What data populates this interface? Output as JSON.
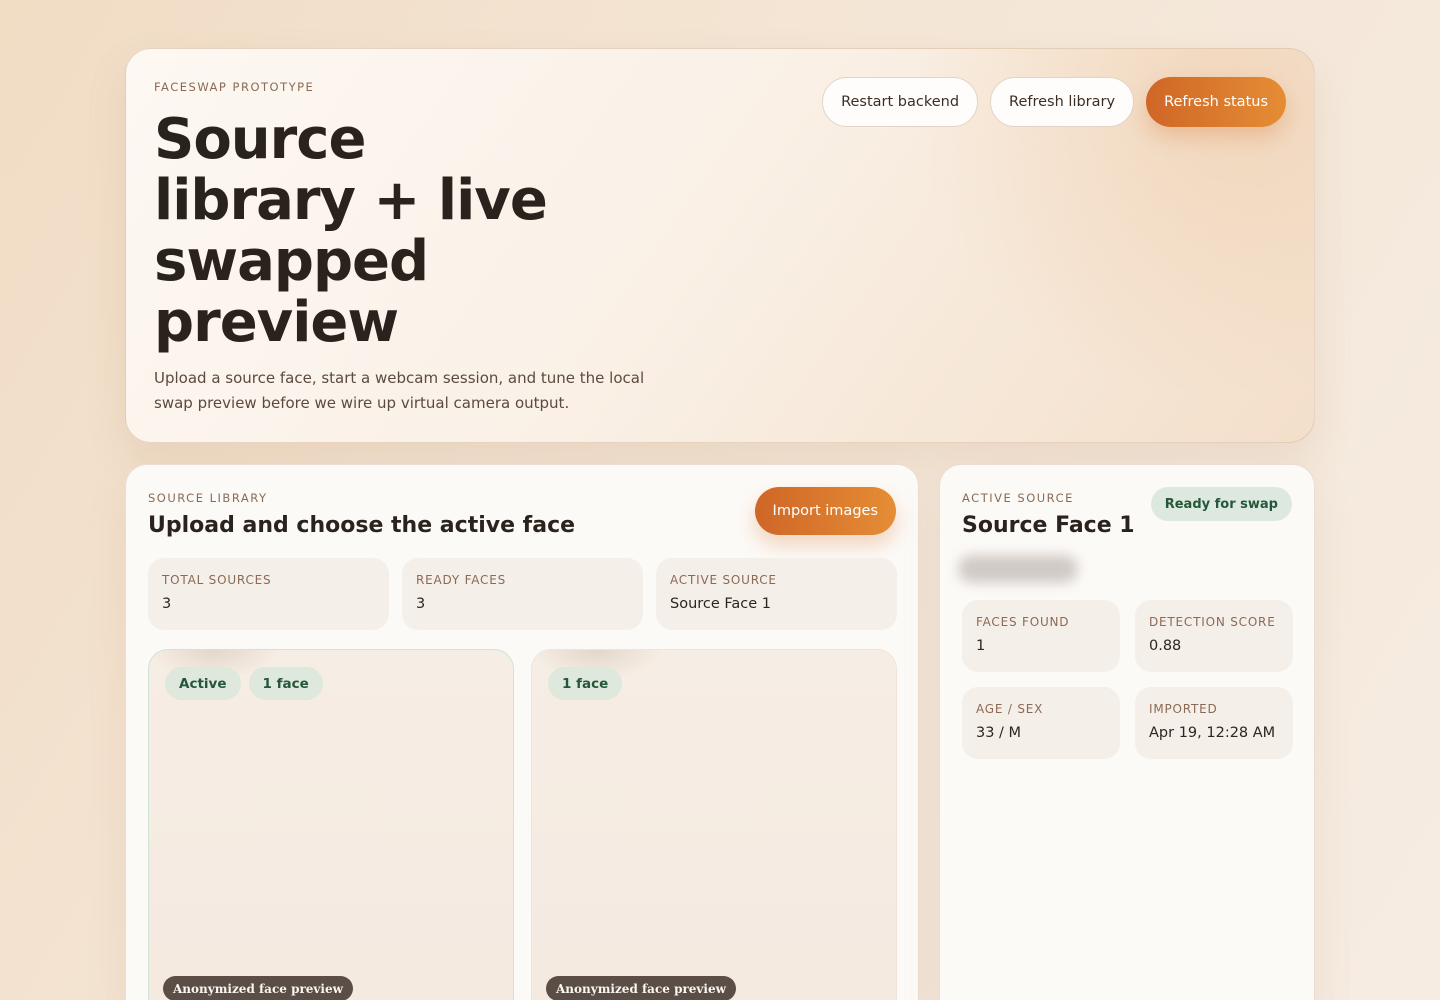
{
  "hero": {
    "eyebrow": "FACESWAP PROTOTYPE",
    "title": "Source library + live swapped preview",
    "subtitle": "Upload a source face, start a webcam session, and tune the local swap preview before we wire up virtual camera output.",
    "actions": {
      "restart_label": "Restart backend",
      "refresh_library_label": "Refresh library",
      "refresh_status_label": "Refresh status"
    }
  },
  "library": {
    "eyebrow": "SOURCE LIBRARY",
    "title": "Upload and choose the active face",
    "import_label": "Import images",
    "stats": [
      {
        "label": "TOTAL SOURCES",
        "value": "3"
      },
      {
        "label": "READY FACES",
        "value": "3"
      },
      {
        "label": "ACTIVE SOURCE",
        "value": "Source Face 1"
      }
    ],
    "tiles": [
      {
        "badges": [
          "Active",
          "1 face"
        ],
        "caption": "Anonymized face preview"
      },
      {
        "badges": [
          "1 face"
        ],
        "caption": "Anonymized face preview"
      }
    ]
  },
  "active": {
    "eyebrow": "ACTIVE SOURCE",
    "title": "Source Face 1",
    "status": "Ready for swap",
    "details": [
      {
        "label": "FACES FOUND",
        "value": "1"
      },
      {
        "label": "DETECTION SCORE",
        "value": "0.88"
      },
      {
        "label": "AGE / SEX",
        "value": "33 / M"
      },
      {
        "label": "IMPORTED",
        "value": "Apr 19, 12:28 AM"
      }
    ]
  },
  "colors": {
    "accent": "#d9762f",
    "success_bg": "#dfe8dc",
    "success_text": "#24573a",
    "caption_bg": "#5a4e46"
  }
}
